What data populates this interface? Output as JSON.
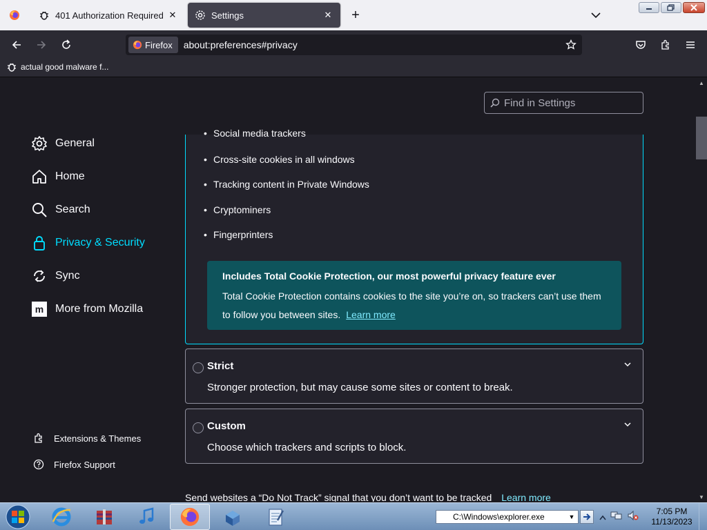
{
  "tabs": [
    {
      "title": "401 Authorization Required",
      "icon": "bug-icon",
      "active": false
    },
    {
      "title": "Settings",
      "icon": "gear-icon",
      "active": true
    }
  ],
  "navbar": {
    "identity_label": "Firefox",
    "url": "about:preferences#privacy"
  },
  "bookmarks": [
    {
      "label": "actual good malware f...",
      "icon": "bug-icon"
    }
  ],
  "search": {
    "placeholder": "Find in Settings"
  },
  "sidebar": {
    "items": [
      {
        "label": "General",
        "icon": "gear-icon"
      },
      {
        "label": "Home",
        "icon": "home-icon"
      },
      {
        "label": "Search",
        "icon": "search-icon"
      },
      {
        "label": "Privacy & Security",
        "icon": "lock-icon",
        "active": true
      },
      {
        "label": "Sync",
        "icon": "sync-icon"
      },
      {
        "label": "More from Mozilla",
        "icon": "mozilla-icon"
      }
    ],
    "footer": [
      {
        "label": "Extensions & Themes",
        "icon": "puzzle-icon"
      },
      {
        "label": "Firefox Support",
        "icon": "help-icon"
      }
    ]
  },
  "standard": {
    "bullets": [
      "Social media trackers",
      "Cross-site cookies in all windows",
      "Tracking content in Private Windows",
      "Cryptominers",
      "Fingerprinters"
    ],
    "tcp_title": "Includes Total Cookie Protection, our most powerful privacy feature ever",
    "tcp_text": "Total Cookie Protection contains cookies to the site you’re on, so trackers can’t use them to follow you between sites.",
    "tcp_link": "Learn more"
  },
  "options": [
    {
      "title": "Strict",
      "desc": "Stronger protection, but may cause some sites or content to break."
    },
    {
      "title": "Custom",
      "desc": "Choose which trackers and scripts to block."
    }
  ],
  "dnt": {
    "text": "Send websites a “Do Not Track” signal that you don’t want to be tracked",
    "link": "Learn more"
  },
  "taskbar": {
    "run_value": "C:\\Windows\\explorer.exe",
    "time": "7:05 PM",
    "date": "11/13/2023"
  },
  "colors": {
    "accent": "#00ddff",
    "link": "#80ebff",
    "background": "#1c1b22",
    "tcp_background": "#0e545c"
  }
}
